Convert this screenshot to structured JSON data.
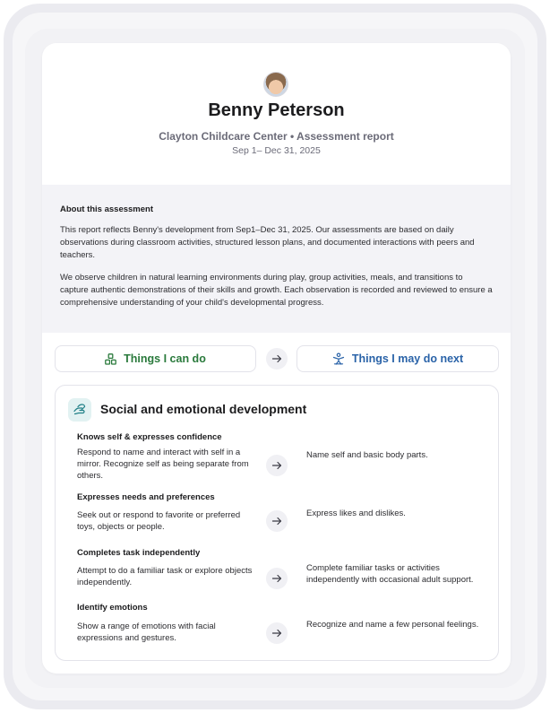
{
  "header": {
    "name": "Benny Peterson",
    "subtitle": "Clayton Childcare Center • Assessment report",
    "date_range": "Sep 1– Dec 31, 2025"
  },
  "about": {
    "title": "About this assessment",
    "paragraphs": [
      "This report reflects Benny's development from Sep1–Dec 31, 2025. Our assessments are based on daily observations during classroom activities, structured lesson plans, and documented interactions with peers and teachers.",
      "We observe children in natural learning environments during play, group activities, meals, and transitions to capture authentic demonstrations of their skills and growth. Each observation is recorded and reviewed to ensure a comprehensive understanding of your child's developmental progress."
    ]
  },
  "tabs": {
    "can_do": {
      "label": "Things I can do",
      "icon": "blocks-icon",
      "color": "#2a7a3c"
    },
    "next": {
      "label": "Things I may do next",
      "icon": "child-reaching-icon",
      "color": "#2a63a8"
    }
  },
  "section": {
    "title": "Social and emotional development",
    "icon": "hands-icon",
    "skills": [
      {
        "title": "Knows self & expresses confidence",
        "now": "Respond to name and interact with self in a mirror. Recognize self as being separate from others.",
        "next": "Name self and basic body parts."
      },
      {
        "title": "Expresses needs and preferences",
        "now": "Seek out or respond to favorite or preferred toys, objects or people.",
        "next": "Express likes and dislikes."
      },
      {
        "title": "Completes task independently",
        "now": "Attempt to do a familiar task or explore objects independently.",
        "next": "Complete familiar tasks or activities independently with occasional adult support."
      },
      {
        "title": "Identify emotions",
        "now": "Show a range of emotions with facial expressions and gestures.",
        "next": "Recognize and name a few personal feelings."
      }
    ]
  }
}
